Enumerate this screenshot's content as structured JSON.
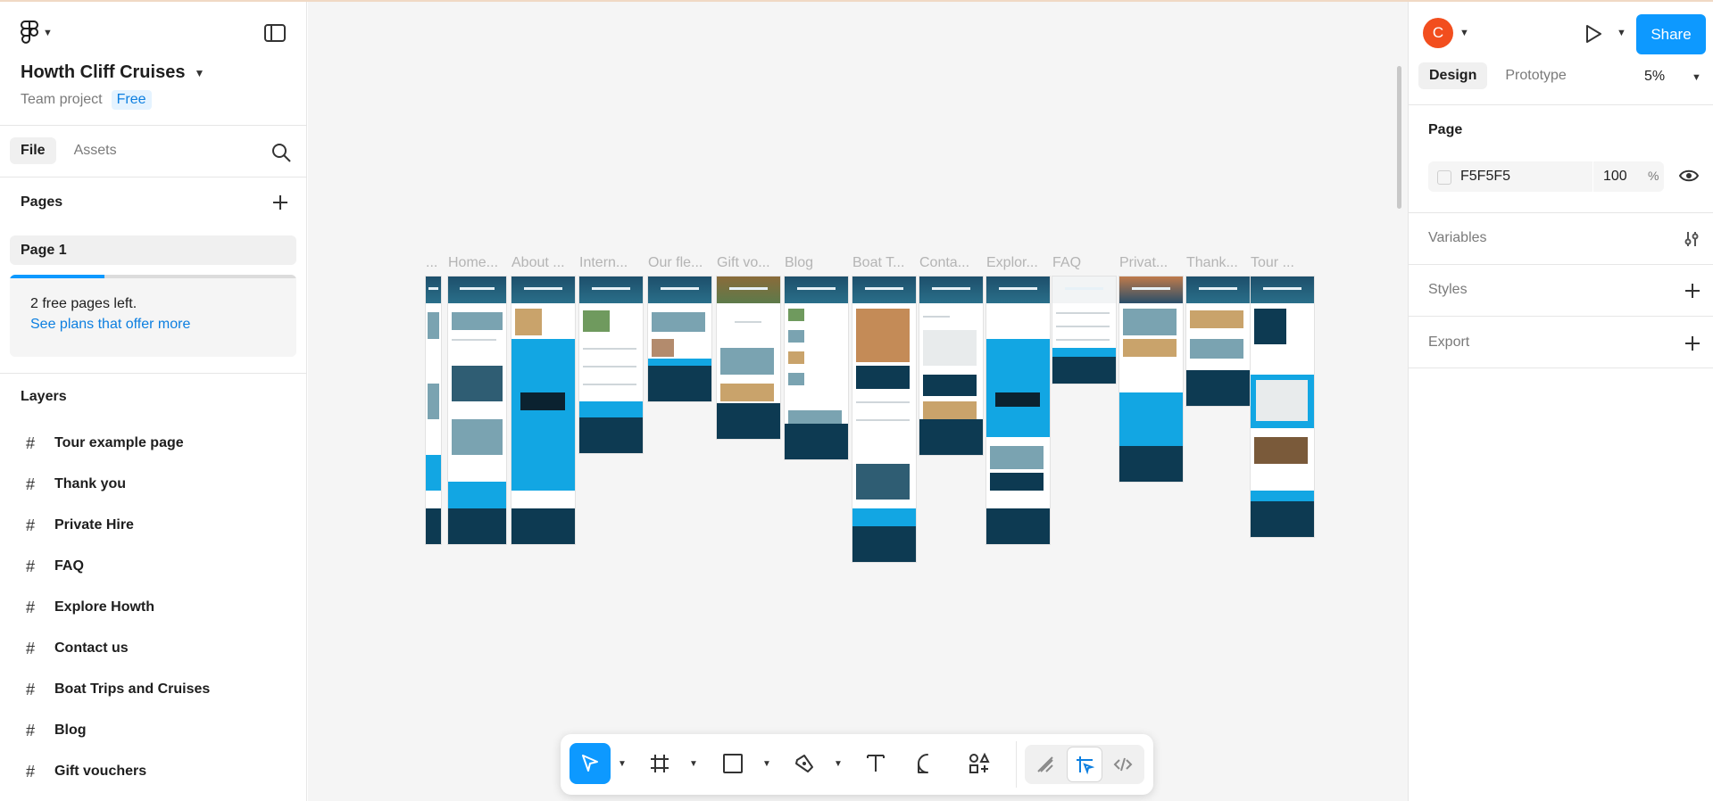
{
  "header": {
    "project_name": "Howth Cliff Cruises",
    "project_type": "Team project",
    "plan_badge": "Free"
  },
  "file_tabs": [
    "File",
    "Assets"
  ],
  "pages": {
    "heading": "Pages",
    "items": [
      "Page 1"
    ],
    "free_notice": "2 free pages left.",
    "plans_link": "See plans that offer more",
    "free_used_fraction": 0.33
  },
  "layers": {
    "heading": "Layers",
    "items": [
      "Tour example page",
      "Thank you",
      "Private Hire",
      "FAQ",
      "Explore Howth",
      "Contact us",
      "Boat Trips and Cruises",
      "Blog",
      "Gift vouchers"
    ]
  },
  "canvas": {
    "frame_labels": [
      "...",
      "Home...",
      "About ...",
      "Intern...",
      "Our fle...",
      "Gift vo...",
      "Blog",
      "Boat T...",
      "Conta...",
      "Explor...",
      "FAQ",
      "Privat...",
      "Thank...",
      "Tour ..."
    ]
  },
  "right_panel": {
    "avatar_initial": "C",
    "share_label": "Share",
    "tabs": [
      "Design",
      "Prototype"
    ],
    "zoom": "5%",
    "page_heading": "Page",
    "page_color_hex": "F5F5F5",
    "page_opacity": "100",
    "opacity_unit": "%",
    "variables_label": "Variables",
    "styles_label": "Styles",
    "export_label": "Export"
  },
  "help_label": "?",
  "colors": {
    "accent": "#0d99ff",
    "avatar": "#f24e1e",
    "canvas": "#f5f5f5"
  },
  "icons": [
    "figma-logo-icon",
    "panel-toggle-icon",
    "search-icon",
    "plus-icon",
    "frame-hash-icon",
    "move-tool-icon",
    "frame-tool-icon",
    "rectangle-tool-icon",
    "pen-tool-icon",
    "text-tool-icon",
    "comment-tool-icon",
    "actions-icon",
    "draw-mode-icon",
    "design-mode-icon",
    "dev-mode-icon",
    "play-icon",
    "eye-icon",
    "adjust-icon"
  ]
}
